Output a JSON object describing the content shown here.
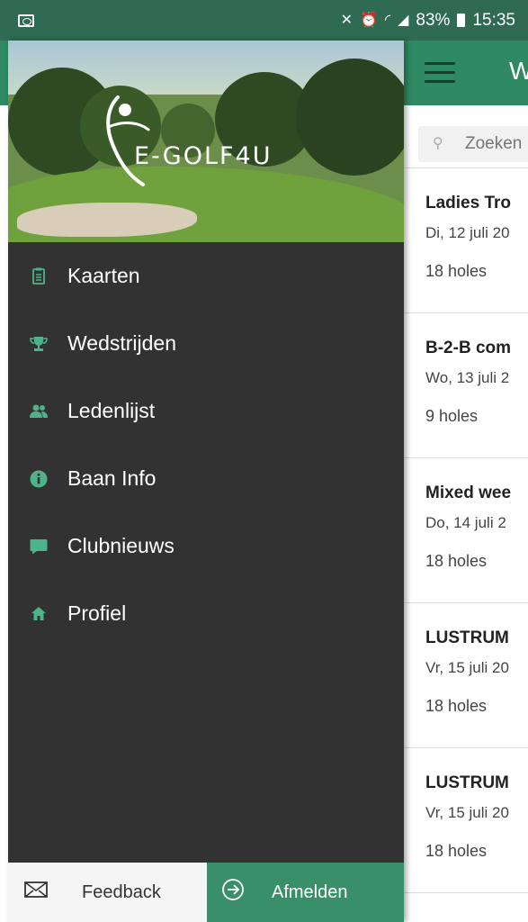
{
  "status_bar": {
    "battery": "83%",
    "time": "15:35"
  },
  "app_bar": {
    "title": "W"
  },
  "search": {
    "placeholder": "Zoeken"
  },
  "competitions": [
    {
      "title": "Ladies Tro",
      "date": "Di, 12 juli 20",
      "holes": "18 holes"
    },
    {
      "title": "B-2-B com",
      "date": "Wo, 13 juli 2",
      "holes": "9 holes"
    },
    {
      "title": "Mixed wee",
      "date": "Do, 14 juli 2",
      "holes": "18 holes"
    },
    {
      "title": "LUSTRUM",
      "date": "Vr, 15 juli 20",
      "holes": "18 holes"
    },
    {
      "title": "LUSTRUM",
      "date": "Vr, 15 juli 20",
      "holes": "18 holes"
    }
  ],
  "drawer": {
    "logo_text": "E-GOLF4U",
    "menu": [
      {
        "label": "Kaarten",
        "icon": "clipboard-icon"
      },
      {
        "label": "Wedstrijden",
        "icon": "trophy-icon"
      },
      {
        "label": "Ledenlijst",
        "icon": "users-icon"
      },
      {
        "label": "Baan Info",
        "icon": "info-icon"
      },
      {
        "label": "Clubnieuws",
        "icon": "chat-bubble-icon"
      },
      {
        "label": "Profiel",
        "icon": "home-icon"
      }
    ],
    "footer": {
      "feedback_label": "Feedback",
      "logout_label": "Afmelden"
    }
  },
  "colors": {
    "status_bar": "#2e6b52",
    "app_bar": "#2f8a63",
    "drawer_bg": "#323232",
    "accent": "#4db38a",
    "logout_bg": "#3a8f6b"
  }
}
